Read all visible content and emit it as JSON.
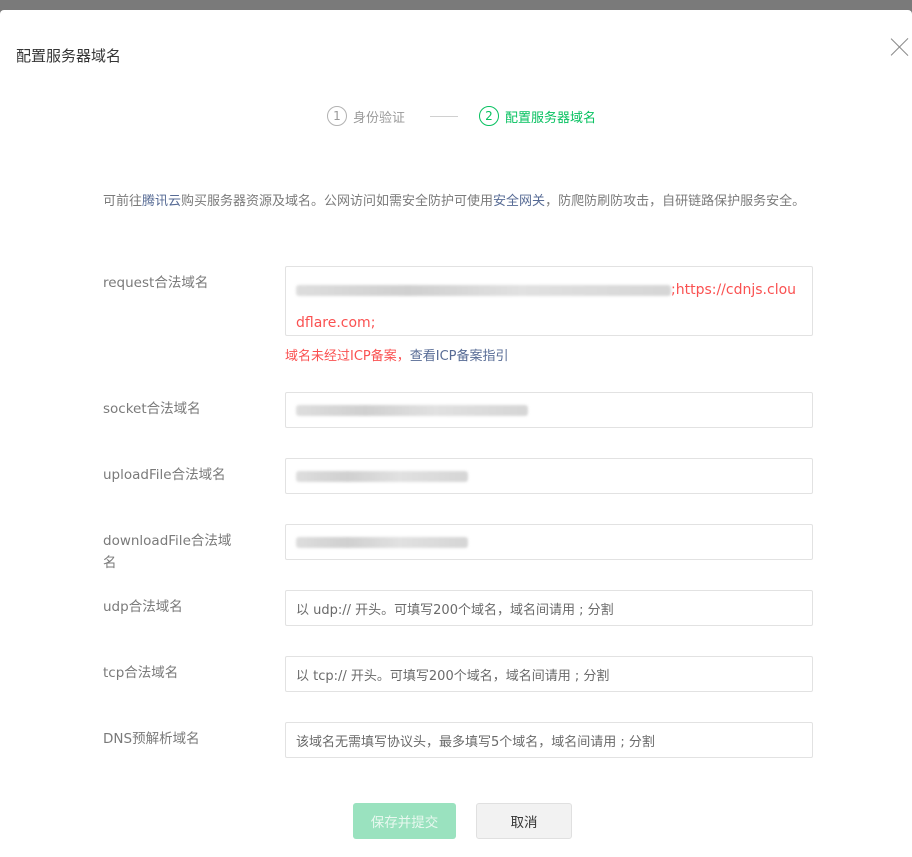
{
  "dialog": {
    "title": "配置服务器域名"
  },
  "steps": [
    {
      "num": "1",
      "label": "身份验证",
      "active": false
    },
    {
      "num": "2",
      "label": "配置服务器域名",
      "active": true
    }
  ],
  "notice": {
    "prefix": "可前往",
    "link1": "腾讯云",
    "middle": "购买服务器资源及域名。公网访问如需安全防护可使用",
    "link2": "安全网关",
    "suffix": "，防爬防刷防攻击，自研链路保护服务安全。"
  },
  "fields": {
    "request": {
      "label": "request合法域名",
      "value_visible": ";https://cdnjs.cloudflare.com;",
      "error_prefix": "域名未经过ICP备案，",
      "error_link": "查看ICP备案指引"
    },
    "socket": {
      "label": "socket合法域名"
    },
    "uploadFile": {
      "label": "uploadFile合法域名"
    },
    "downloadFile": {
      "label": "downloadFile合法域名"
    },
    "udp": {
      "label": "udp合法域名",
      "placeholder": "以 udp:// 开头。可填写200个域名，域名间请用 ; 分割"
    },
    "tcp": {
      "label": "tcp合法域名",
      "placeholder": "以 tcp:// 开头。可填写200个域名，域名间请用 ; 分割"
    },
    "dns": {
      "label": "DNS预解析域名",
      "placeholder": "该域名无需填写协议头，最多填写5个域名，域名间请用 ; 分割"
    }
  },
  "buttons": {
    "submit": "保存并提交",
    "cancel": "取消"
  },
  "colors": {
    "accent": "#07c160",
    "error": "#fa5151",
    "link": "#576b95"
  }
}
